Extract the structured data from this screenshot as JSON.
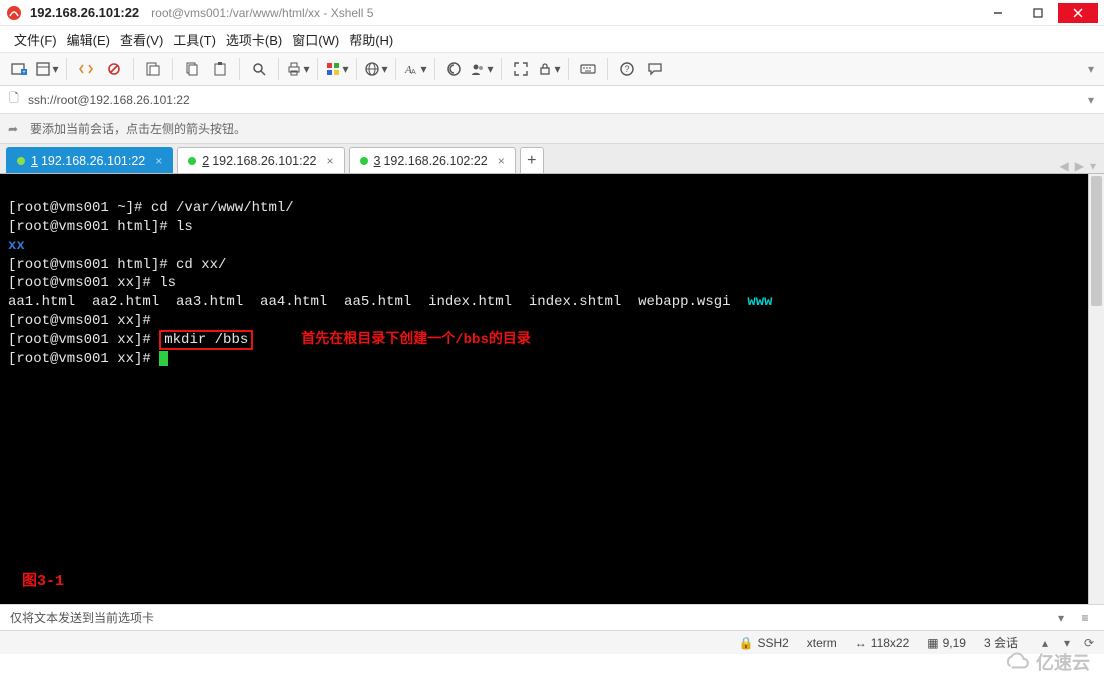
{
  "title": {
    "ip": "192.168.26.101:22",
    "path": "root@vms001:/var/www/html/xx - Xshell 5"
  },
  "menu": {
    "file": "文件(F)",
    "edit": "编辑(E)",
    "view": "查看(V)",
    "tools": "工具(T)",
    "tabs": "选项卡(B)",
    "window": "窗口(W)",
    "help": "帮助(H)"
  },
  "addr": {
    "url": "ssh://root@192.168.26.101:22"
  },
  "hint": {
    "text": "要添加当前会话，点击左侧的箭头按钮。"
  },
  "tabs": [
    {
      "num": "1",
      "label": "192.168.26.101:22",
      "active": true
    },
    {
      "num": "2",
      "label": "192.168.26.101:22",
      "active": false
    },
    {
      "num": "3",
      "label": "192.168.26.102:22",
      "active": false
    }
  ],
  "term": {
    "l1": "[root@vms001 ~]# cd /var/www/html/",
    "l2": "[root@vms001 html]# ls",
    "l3": "xx",
    "l4": "[root@vms001 html]# cd xx/",
    "l5": "[root@vms001 xx]# ls",
    "files": "aa1.html  aa2.html  aa3.html  aa4.html  aa5.html  index.html  index.shtml  webapp.wsgi  ",
    "www": "www",
    "l7": "[root@vms001 xx]#",
    "l8p": "[root@vms001 xx]# ",
    "cmd": "mkdir /bbs",
    "anno": "首先在根目录下创建一个/bbs的目录",
    "l9": "[root@vms001 xx]# ",
    "fig": "图3-1"
  },
  "status": {
    "text": "仅将文本发送到当前选项卡"
  },
  "footer": {
    "ssh": "SSH2",
    "term": "xterm",
    "size": "118x22",
    "pos": "9,19",
    "sess": "3 会话"
  },
  "brand": "亿速云"
}
